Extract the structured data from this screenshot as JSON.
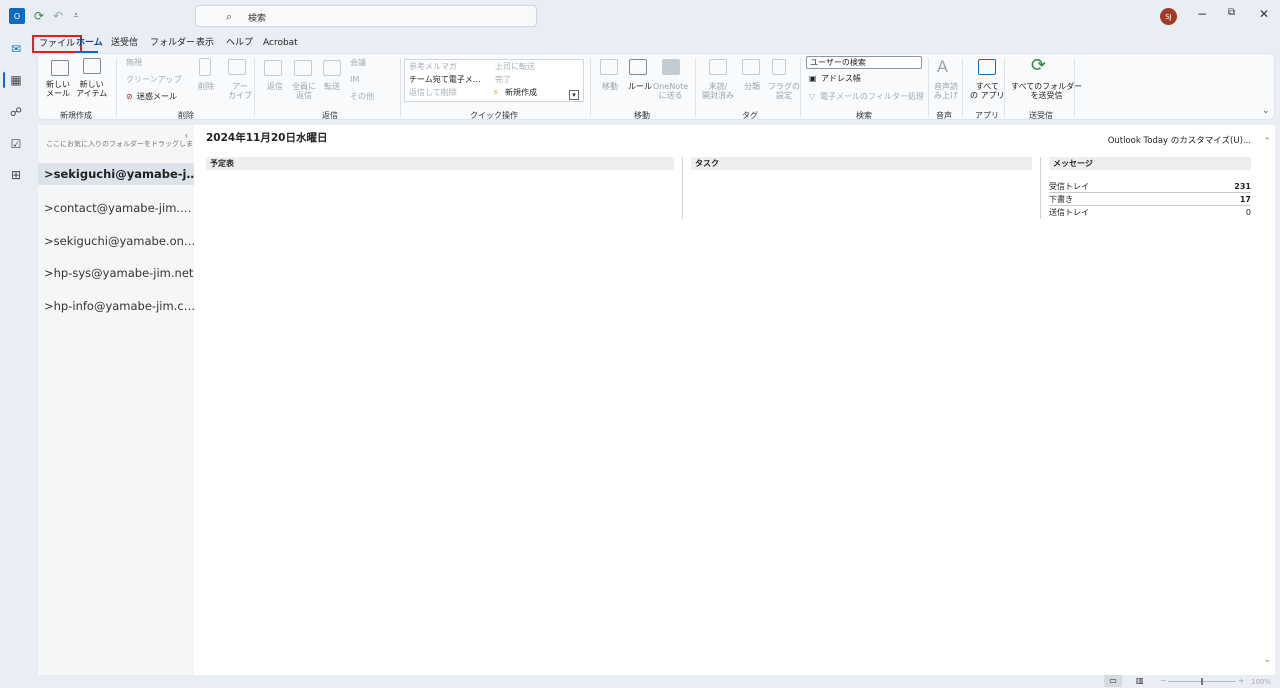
{
  "titlebar": {
    "search_text": "検索",
    "avatar_initials": "SJ",
    "search_icon": "magnifier-icon",
    "sync_icon": "refresh-icon",
    "undo_icon": "undo-icon"
  },
  "menu_tabs": [
    "ファイル",
    "ホーム",
    "送受信",
    "フォルダー",
    "表示",
    "ヘルプ",
    "Acrobat"
  ],
  "ribbon": {
    "new_mail": "新しい\nメール",
    "new_item": "新しい\nアイテム",
    "group_new": "新規作成",
    "ignore": "無視",
    "cleanup": "クリーンアップ",
    "junk": "迷惑メール",
    "delete": "削除",
    "archive": "アー\nカイブ",
    "group_delete": "削除",
    "reply": "返信",
    "reply_all": "全員に\n返信",
    "forward": "転送",
    "meeting": "会議",
    "im": "IM",
    "more": "その他",
    "group_respond": "返信",
    "qs_1": "参考メルマガ",
    "qs_2": "チーム宛て電子メ…",
    "qs_3": "返信して削除",
    "qs_4": "上司に転送",
    "qs_5": "完了",
    "qs_6": "新規作成",
    "group_quick": "クイック操作",
    "move": "移動",
    "rules": "ルール",
    "onenote": "OneNote\nに送る",
    "group_move": "移動",
    "unread": "未読/\n開封済み",
    "categorize": "分類",
    "flag": "フラグの\n設定",
    "group_tags": "タグ",
    "user_search": "ユーザーの検索",
    "address_book": "アドレス帳",
    "filter_mail": "電子メールのフィルター処理",
    "group_find": "検索",
    "read_aloud": "音声読\nみ上げ",
    "group_speech": "音声",
    "all_apps": "すべて\nの アプリ",
    "group_apps": "アプリ",
    "send_receive_all": "すべてのフォルダー\nを送受信",
    "group_sendreceive": "送受信"
  },
  "folder_pane": {
    "fav_hint": "ここにお気に入りのフォルダーをドラッグします",
    "accounts": [
      "sekiguchi@yamabe-j…",
      "contact@yamabe-jim.…",
      "sekiguchi@yamabe.on…",
      "hp-sys@yamabe-jim.net",
      "hp-info@yamabe-jim.c…"
    ]
  },
  "today": {
    "date": "2024年11月20日水曜日",
    "customize": "Outlook Today のカスタマイズ(U)...",
    "calendar": "予定表",
    "tasks": "タスク",
    "messages": "メッセージ",
    "message_rows": [
      {
        "label": "受信トレイ",
        "value": "231"
      },
      {
        "label": "下書き",
        "value": "17"
      },
      {
        "label": "送信トレイ",
        "value": "0"
      }
    ]
  },
  "status": {
    "zoom": "100%"
  },
  "colors": {
    "accent": "#0f6cbd",
    "highlight": "#e02020"
  }
}
